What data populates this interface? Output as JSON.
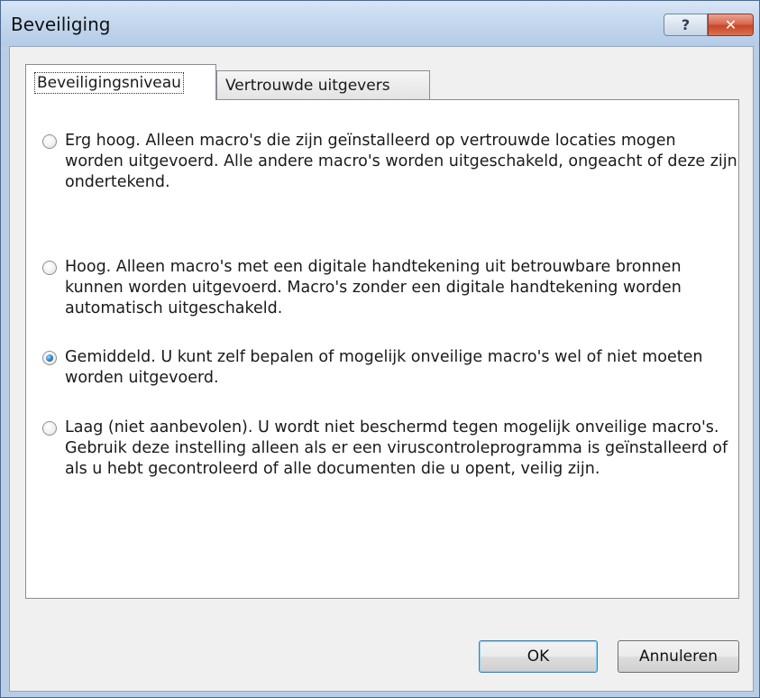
{
  "window": {
    "title": "Beveiliging",
    "help_glyph": "?",
    "close_glyph": "✕"
  },
  "tabs": [
    {
      "label": "Beveiligingsniveau",
      "active": true
    },
    {
      "label": "Vertrouwde uitgevers",
      "active": false
    }
  ],
  "options": [
    {
      "text": "Erg hoog. Alleen macro's die zijn geïnstalleerd op vertrouwde locaties mogen worden uitgevoerd. Alle andere macro's worden uitgeschakeld, ongeacht of deze zijn ondertekend.",
      "checked": false
    },
    {
      "text": "Hoog. Alleen macro's met een digitale handtekening uit betrouwbare bronnen kunnen worden uitgevoerd. Macro's zonder een digitale handtekening worden automatisch uitgeschakeld.",
      "checked": false
    },
    {
      "text": "Gemiddeld. U kunt zelf bepalen of mogelijk onveilige macro's wel of niet moeten worden uitgevoerd.",
      "checked": true
    },
    {
      "text": "Laag (niet aanbevolen). U wordt niet beschermd tegen mogelijk onveilige macro's. Gebruik deze instelling alleen als er een viruscontroleprogramma is geïnstalleerd of als u hebt gecontroleerd of alle documenten die u opent, veilig zijn.",
      "checked": false
    }
  ],
  "buttons": {
    "ok": "OK",
    "cancel": "Annuleren"
  },
  "colors": {
    "titlebar": "#c3d7ee",
    "close_button": "#c9452a",
    "radio_selected": "#2b7ec4"
  },
  "icons": {
    "help": "help-icon",
    "close": "close-icon"
  }
}
